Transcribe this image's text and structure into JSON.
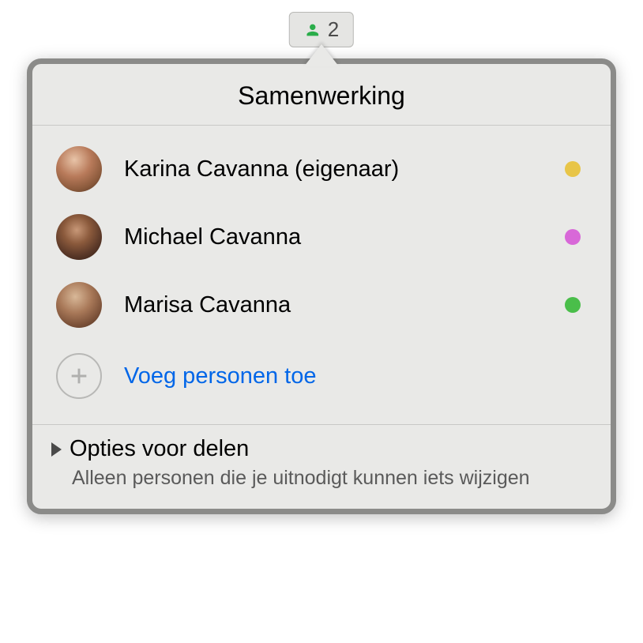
{
  "toolbar": {
    "collaborator_count": "2"
  },
  "popover": {
    "title": "Samenwerking",
    "participants": [
      {
        "name": "Karina Cavanna (eigenaar)",
        "dot_color": "#e8c548"
      },
      {
        "name": "Michael Cavanna",
        "dot_color": "#d868d8"
      },
      {
        "name": "Marisa Cavanna",
        "dot_color": "#4abe4a"
      }
    ],
    "add_label": "Voeg personen toe",
    "share_options": {
      "title": "Opties voor delen",
      "subtitle": "Alleen personen die je uitnodigt kunnen iets wijzigen"
    }
  }
}
